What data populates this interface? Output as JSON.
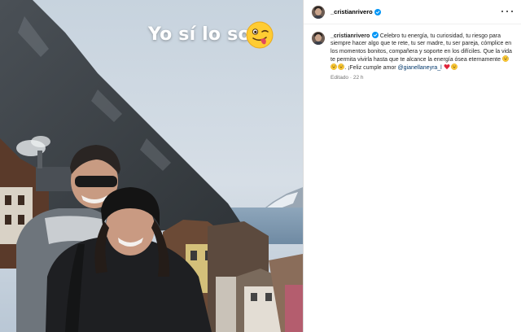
{
  "media": {
    "overlay_text": "Yo sí lo soy",
    "overlay_emoji": "winking-tongue-emoji"
  },
  "post": {
    "username": "_cristianrivero",
    "verified": true
  },
  "caption": {
    "username": "_cristianrivero",
    "text": "Celebro tu energía, tu curiosidad, tu riesgo para siempre hacer algo que te rete, tu ser madre, tu ser pareja, cómplice en los momentos bonitos, compañera y soporte en los difíciles. Que la vida te permita vivirla hasta que te alcance la energía ósea eternamente",
    "emojis_after_text": [
      "grinning-sweat-emoji",
      "grinning-sweat-emoji",
      "grinning-sweat-emoji"
    ],
    "closing": ". ¡Feliz cumple amor",
    "mention": "@gianellaneyra_l",
    "emojis_after_mention": [
      "red-heart-emoji",
      "grinning-emoji"
    ],
    "edited_label": "Editado",
    "separator": "·",
    "time_ago": "22 h"
  },
  "colors": {
    "verified_blue": "#0095f6",
    "mention_blue": "#00376b",
    "meta_gray": "#737373",
    "border": "#dbdbdb"
  }
}
